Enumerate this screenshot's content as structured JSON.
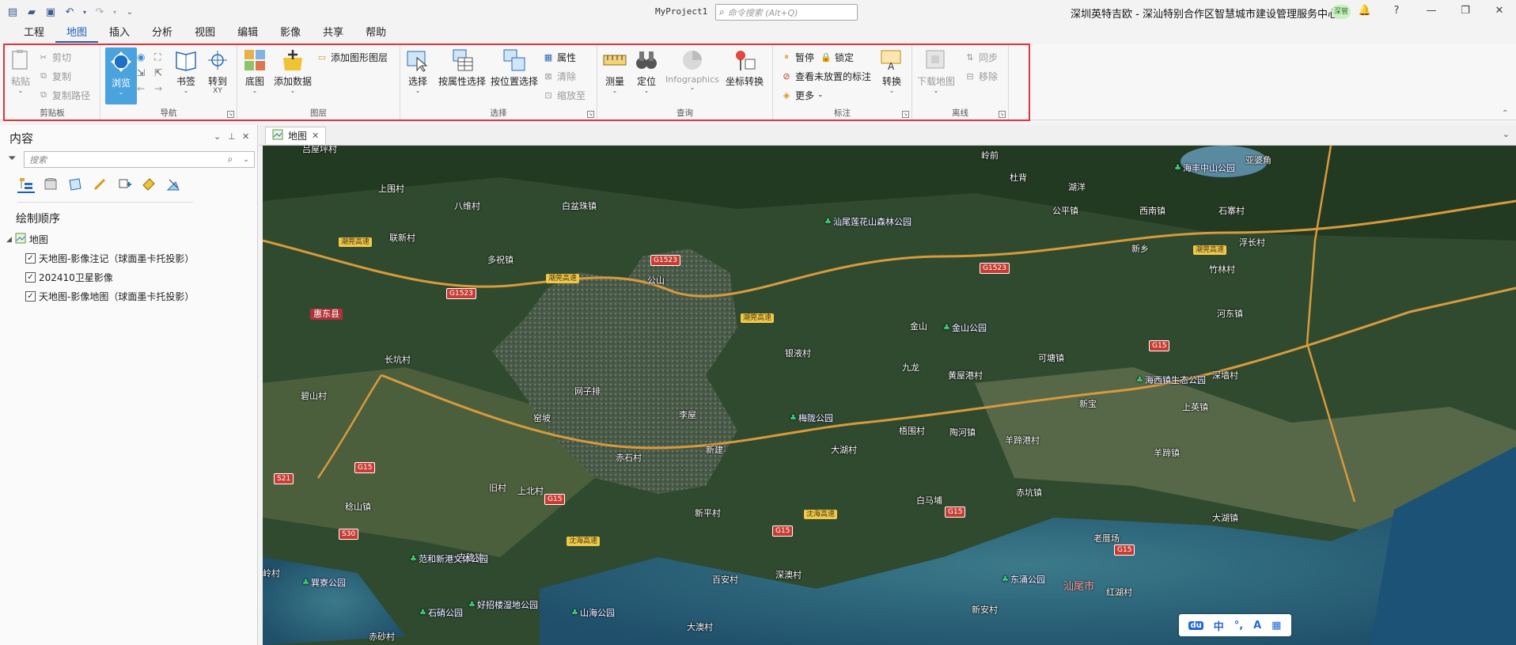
{
  "titlebar": {
    "project": "MyProject1",
    "search_placeholder": "命令搜索 (Alt+Q)",
    "organization": "深圳英特吉欧 - 深汕特别合作区智慧城市建设管理服务中心",
    "user": "深管"
  },
  "menu": {
    "tabs": [
      "工程",
      "地图",
      "插入",
      "分析",
      "视图",
      "编辑",
      "影像",
      "共享",
      "帮助"
    ],
    "active": "地图"
  },
  "ribbon": {
    "clipboard": {
      "label": "剪贴板",
      "paste": "粘贴",
      "cut": "剪切",
      "copy": "复制",
      "copy_path": "复制路径"
    },
    "navigate": {
      "label": "导航",
      "explore": "浏览",
      "bookmarks": "书签",
      "goto": "转到",
      "goto_sub": "XY"
    },
    "layer": {
      "label": "图层",
      "basemap": "底图",
      "add_data": "添加数据",
      "add_graphics": "添加图形图层"
    },
    "selection": {
      "label": "选择",
      "select": "选择",
      "by_attr": "按属性选择",
      "by_loc": "按位置选择",
      "attributes": "属性",
      "clear": "清除",
      "zoom_to": "缩放至"
    },
    "inquiry": {
      "label": "查询",
      "measure": "测量",
      "locate": "定位",
      "infographics": "Infographics",
      "coord": "坐标转换"
    },
    "labeling": {
      "label": "标注",
      "pause": "暂停",
      "lock": "锁定",
      "view_unplaced": "查看未放置的标注",
      "more": "更多",
      "convert": "转换"
    },
    "offline": {
      "label": "离线",
      "download": "下载地图",
      "sync": "同步",
      "remove": "移除"
    }
  },
  "contents": {
    "title": "内容",
    "search_placeholder": "搜索",
    "drawing_order": "绘制顺序",
    "map_name": "地图",
    "layers": [
      {
        "name": "天地图-影像注记（球面墨卡托投影）",
        "checked": true
      },
      {
        "name": "202410卫星影像",
        "checked": true
      },
      {
        "name": "天地图-影像地图（球面墨卡托投影）",
        "checked": true
      }
    ]
  },
  "map_tab": {
    "label": "地图"
  },
  "map": {
    "places": [
      "吕屋坪村",
      "上围村",
      "八维村",
      "白盆珠镇",
      "联新村",
      "多祝镇",
      "公山",
      "惠东县",
      "长坑村",
      "碧山村",
      "网子排",
      "李屋",
      "窑坡",
      "赤石村",
      "旧村",
      "上北村",
      "稔山镇",
      "吉隆镇",
      "百安村",
      "深澳村",
      "新平村",
      "新建",
      "大湖村",
      "梧围村",
      "陶河镇",
      "羊蹄港村",
      "银液村",
      "九龙",
      "黄屋港村",
      "金山",
      "可塘镇",
      "新宝",
      "羊蹄镇",
      "赤坑镇",
      "白马埔",
      "老厝场",
      "红湖村",
      "大湖镇",
      "新安村",
      "大澳村",
      "赤砂村",
      "岭村",
      "湖洋",
      "公平镇",
      "西南镇",
      "石寨村",
      "新乡",
      "竹林村",
      "浮长村",
      "河东镇",
      "上英镇",
      "深墙村",
      "岭前",
      "杜背",
      "亚婆角",
      "汕尾市"
    ],
    "parks": [
      "汕尾莲花山森林公园",
      "海丰中山公园",
      "金山公园",
      "海西镇生态公园",
      "梅陇公园",
      "东涌公园",
      "巽寮公园",
      "范和新港文体公园",
      "石硝公园",
      "好招楼湿地公园",
      "山海公园"
    ],
    "shields": [
      "G1523",
      "G1523",
      "G1523",
      "G15",
      "G15",
      "G15",
      "G15",
      "G15",
      "G15",
      "S21",
      "S30"
    ],
    "expressway_labels": [
      "潮莞高速",
      "潮莞高速",
      "潮莞高速",
      "潮莞高速",
      "沈海高速",
      "沈海高速"
    ],
    "ime": [
      "du",
      "中",
      "°,",
      "A",
      "▦"
    ]
  }
}
